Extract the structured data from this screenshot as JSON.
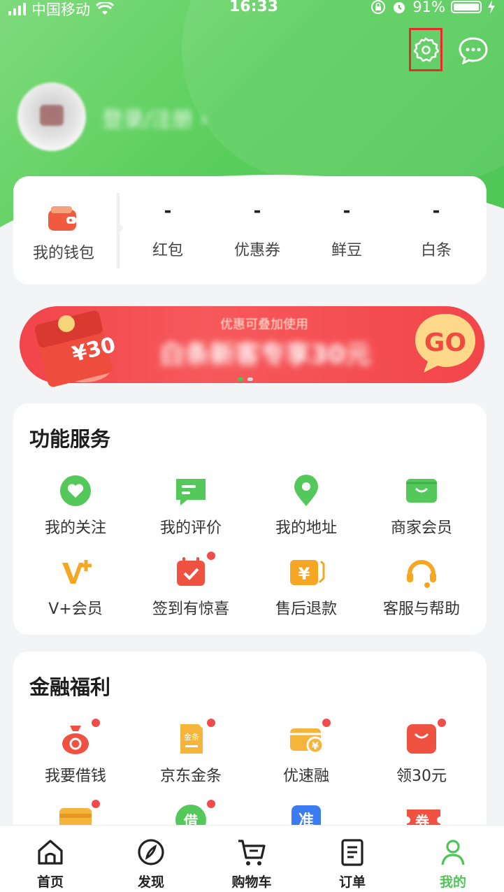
{
  "status_bar": {
    "carrier": "中国移动",
    "time": "16:33",
    "battery": "91%",
    "battery_level": 0.91
  },
  "header": {
    "login_text": "登录/注册 ›",
    "settings_icon": "gear-icon",
    "message_icon": "chat-bubble-icon"
  },
  "wallet": {
    "label": "我的钱包",
    "stats": [
      {
        "value": "-",
        "label": "红包"
      },
      {
        "value": "-",
        "label": "优惠券"
      },
      {
        "value": "-",
        "label": "鲜豆"
      },
      {
        "value": "-",
        "label": "白条"
      }
    ]
  },
  "banner": {
    "subtitle": "优惠可叠加使用",
    "title": "白条新客专享30元",
    "envelope_text": "¥30",
    "go_text": "GO"
  },
  "services": {
    "title": "功能服务",
    "items": [
      {
        "label": "我的关注",
        "icon": "heart-icon"
      },
      {
        "label": "我的评价",
        "icon": "comment-icon"
      },
      {
        "label": "我的地址",
        "icon": "location-pin-icon"
      },
      {
        "label": "商家会员",
        "icon": "member-card-icon"
      },
      {
        "label": "V+会员",
        "icon": "vplus-icon"
      },
      {
        "label": "签到有惊喜",
        "icon": "calendar-check-icon"
      },
      {
        "label": "售后退款",
        "icon": "refund-icon"
      },
      {
        "label": "客服与帮助",
        "icon": "headset-icon"
      }
    ]
  },
  "finance": {
    "title": "金融福利",
    "items": [
      {
        "label": "我要借钱",
        "icon": "money-bag-icon"
      },
      {
        "label": "京东金条",
        "icon": "gold-bar-icon",
        "badge_text": "金条"
      },
      {
        "label": "优速融",
        "icon": "wallet-yen-icon"
      },
      {
        "label": "领30元",
        "icon": "shopping-bag-icon"
      }
    ],
    "partial_row": [
      {
        "icon": "card-icon"
      },
      {
        "icon": "borrow-icon",
        "badge_text": "借"
      },
      {
        "icon": "zhun-icon",
        "badge_text": "准"
      },
      {
        "icon": "coupon-icon",
        "badge_text": "券"
      }
    ]
  },
  "tabbar": {
    "tabs": [
      {
        "label": "首页",
        "icon": "home-icon"
      },
      {
        "label": "发现",
        "icon": "compass-icon"
      },
      {
        "label": "购物车",
        "icon": "cart-icon"
      },
      {
        "label": "订单",
        "icon": "order-list-icon"
      },
      {
        "label": "我的",
        "icon": "profile-icon"
      }
    ],
    "active_index": 4
  },
  "colors": {
    "brand_green": "#4ec556",
    "banner_red": "#f2444b",
    "highlight_red": "#e52b2b"
  }
}
